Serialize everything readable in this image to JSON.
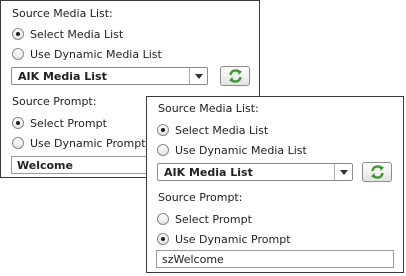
{
  "back_panel": {
    "source_media_list_label": "Source Media List:",
    "media_options": [
      {
        "label": "Select Media List",
        "selected": true
      },
      {
        "label": "Use Dynamic Media List",
        "selected": false
      }
    ],
    "media_list_value": "AIK Media List",
    "source_prompt_label": "Source Prompt:",
    "prompt_options": [
      {
        "label": "Select Prompt",
        "selected": true
      },
      {
        "label": "Use Dynamic Prompt",
        "selected": false
      }
    ],
    "prompt_value": "Welcome"
  },
  "front_panel": {
    "source_media_list_label": "Source Media List:",
    "media_options": [
      {
        "label": "Select Media List",
        "selected": true
      },
      {
        "label": "Use Dynamic Media List",
        "selected": false
      }
    ],
    "media_list_value": "AIK Media List",
    "source_prompt_label": "Source Prompt:",
    "prompt_options": [
      {
        "label": "Select Prompt",
        "selected": false
      },
      {
        "label": "Use Dynamic Prompt",
        "selected": true
      }
    ],
    "prompt_value": "szWelcome"
  },
  "icons": {
    "refresh": "refresh-icon",
    "dropdown": "chevron-down-icon"
  },
  "colors": {
    "refresh_green": "#3a9a2e",
    "border": "#3a3a3a"
  }
}
